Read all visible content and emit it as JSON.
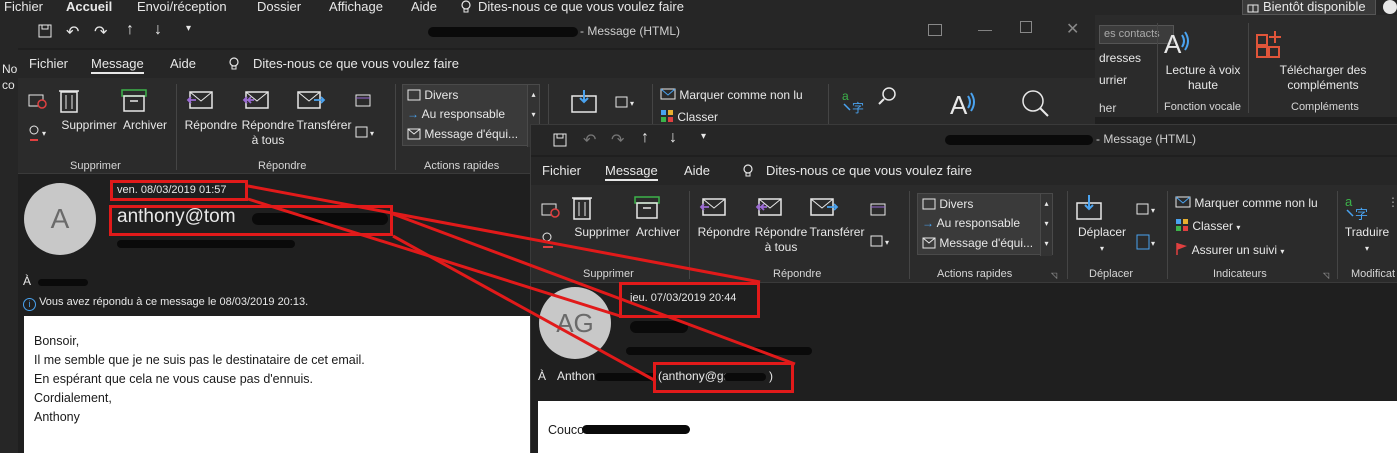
{
  "main_menu": {
    "items": [
      "Fichier",
      "Accueil",
      "Envoi/réception",
      "Dossier",
      "Affichage",
      "Aide"
    ],
    "tell_me": "Dites-nous ce que vous voulez faire",
    "coming_soon": "Bientôt disponible"
  },
  "main_ribbon": {
    "contacts_fragment": "es contacts",
    "addresses_fragment": "dresses",
    "mail_fragment": "urrier",
    "filter_fragment": "her",
    "read_aloud": "Lecture à voix haute",
    "voice_group": "Fonction vocale",
    "get_addins": "Télécharger des compléments",
    "addins_group": "Compléments",
    "left_fragment": "No",
    "left_fragment2": "co"
  },
  "win1": {
    "title_suffix": "- Message (HTML)",
    "tabs": [
      "Fichier",
      "Message",
      "Aide"
    ],
    "tell_me": "Dites-nous ce que vous voulez faire",
    "buttons": {
      "delete": "Supprimer",
      "archive": "Archiver",
      "reply": "Répondre",
      "reply_all_1": "Répondre",
      "reply_all_2": "à tous",
      "forward": "Transférer"
    },
    "quick_steps": [
      "Divers",
      "Au responsable",
      "Message d'équi..."
    ],
    "mark_unread": "Marquer comme non lu",
    "classify": "Classer",
    "groups": {
      "delete": "Supprimer",
      "respond": "Répondre",
      "quick": "Actions rapides"
    },
    "header": {
      "avatar_initial": "A",
      "date": "ven. 08/03/2019 01:57",
      "sender": "anthony@tom",
      "to_label": "À",
      "info": "Vous avez répondu à ce message le 08/03/2019 20:13."
    },
    "body_lines": [
      "Bonsoir,",
      "Il me semble que je ne suis pas le destinataire de cet email.",
      "En espérant que cela ne vous cause pas d'ennuis.",
      "Cordialement,",
      "Anthony"
    ]
  },
  "win2": {
    "title_suffix": "- Message (HTML)",
    "tabs": [
      "Fichier",
      "Message",
      "Aide"
    ],
    "tell_me": "Dites-nous ce que vous voulez faire",
    "buttons": {
      "delete": "Supprimer",
      "archive": "Archiver",
      "reply": "Répondre",
      "reply_all_1": "Répondre",
      "reply_all_2": "à tous",
      "forward": "Transférer",
      "move": "Déplacer",
      "translate": "Traduire"
    },
    "quick_steps": [
      "Divers",
      "Au responsable",
      "Message d'équi..."
    ],
    "mark_unread": "Marquer comme non lu",
    "classify": "Classer",
    "follow_up": "Assurer un suivi",
    "groups": {
      "delete": "Supprimer",
      "respond": "Répondre",
      "quick": "Actions rapides",
      "move": "Déplacer",
      "tags": "Indicateurs",
      "modify": "Modificat"
    },
    "header": {
      "avatar_initials": "AG",
      "date": "jeu. 07/03/2019 20:44",
      "to_label": "À",
      "to_name": "Anthon",
      "to_email": "(anthony@ga",
      "to_email_end": ")"
    },
    "body_start": "Couco"
  },
  "colors": {
    "highlight_red": "#e11a1a",
    "ribbon_bg": "#2b2b2b",
    "window_bg": "#1f1f1f"
  }
}
